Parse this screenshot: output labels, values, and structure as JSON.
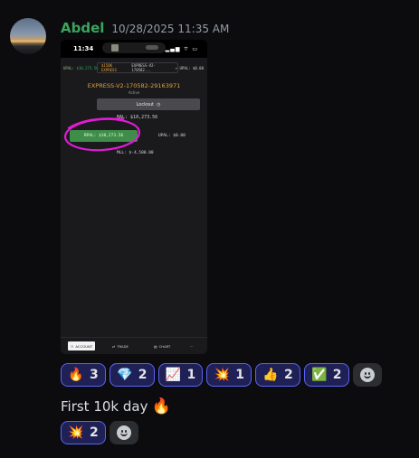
{
  "message": {
    "author": "Abdel",
    "timestamp": "10/28/2025 11:35 AM",
    "text": "First 10k day",
    "text_emoji": "🔥"
  },
  "attachment": {
    "status_time": "11:34",
    "status_icons": "▂▄▆ ⌔ ▭",
    "upal_left_label": "UPAL:",
    "upal_left_value": "$10,273.56",
    "account_tag": "$150K EXPRESS",
    "account_id_short": "EXPRESS-V2-170582...",
    "upal_right": "UPAL: $0.00",
    "account_name": "EXPRESS-V2-170582-29163971",
    "account_status": "Active",
    "lockout_label": "Lockout",
    "bal": "BAL: $10,273.56",
    "rpal": "RPAL: $10,273.56",
    "upal_mid": "UPAL: $0.00",
    "mll": "MLL: $-4,500.00",
    "tabs": [
      {
        "label": "ACCOUNT",
        "icon": "user-icon"
      },
      {
        "label": "TRADE",
        "icon": "trade-icon"
      },
      {
        "label": "CHART",
        "icon": "chart-icon"
      },
      {
        "label": "···",
        "icon": "more-icon"
      }
    ]
  },
  "reactions_row1": [
    {
      "emoji": "🔥",
      "icon": "fire-emoji",
      "count": "3"
    },
    {
      "emoji": "💎",
      "icon": "gem-emoji",
      "count": "2"
    },
    {
      "emoji": "📈",
      "icon": "chart-increasing-emoji",
      "count": "1"
    },
    {
      "emoji": "💥",
      "icon": "collision-emoji",
      "count": "1"
    },
    {
      "emoji": "👍",
      "icon": "thumbs-up-emoji",
      "count": "2"
    },
    {
      "emoji": "✅",
      "icon": "check-mark-emoji",
      "count": "2"
    }
  ],
  "reactions_row2": [
    {
      "emoji": "💥",
      "icon": "collision-emoji",
      "count": "2"
    }
  ],
  "colors": {
    "background": "#0c0c0f",
    "username": "#3ba55d",
    "reaction_border": "#5865f2",
    "reaction_bg": "#1f2156",
    "annotation_circle": "#e11bd6",
    "rpal_green": "#3e8e4a",
    "account_orange": "#e1a23d"
  }
}
